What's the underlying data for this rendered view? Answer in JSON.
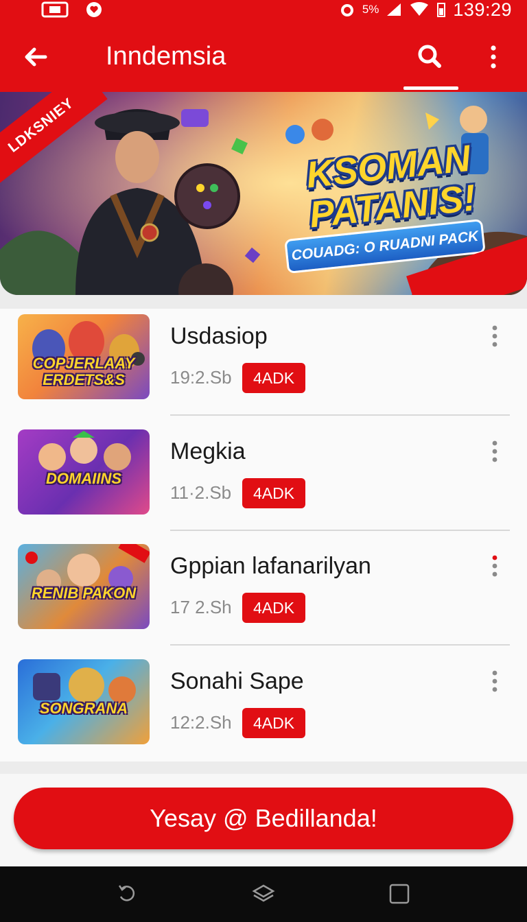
{
  "status_bar": {
    "time": "139:29",
    "misc": "5%",
    "icons": [
      "gallery-icon",
      "heart-icon",
      "alarm-icon",
      "signal-icon",
      "wifi-icon",
      "battery-icon"
    ]
  },
  "app_bar": {
    "title": "Inndemsia",
    "icons": [
      "back-arrow-icon",
      "search-icon",
      "more-vertical-icon"
    ]
  },
  "banner": {
    "corner_label": "LDKSNIEY",
    "headline": "KSOMAN PATANIS!",
    "pack_label": "COUADG: O RUADNI PACK"
  },
  "list": {
    "items": [
      {
        "title": "Usdasiop",
        "size": "19:2.Sb",
        "badge": "4ADK",
        "thumb_text": "COPJERLAAY ERDETS&S",
        "menu_color": "#8a8a8a"
      },
      {
        "title": "Megkia",
        "size": "11·2.Sb",
        "badge": "4ADK",
        "thumb_text": "DOMAIINS",
        "menu_color": "#8a8a8a"
      },
      {
        "title": "Gppian lafanarilyan",
        "size": "17 2.Sh",
        "badge": "4ADK",
        "thumb_text": "RENIB PAKON",
        "menu_color": "#e10e13"
      },
      {
        "title": "Sonahi Sape",
        "size": "12:2.Sh",
        "badge": "4ADK",
        "thumb_text": "SONGRANA",
        "menu_color": "#8a8a8a"
      }
    ]
  },
  "cta": {
    "label": "Yesay @ Bedillanda!"
  },
  "nav_bar": {
    "icons": [
      "back-nav-icon",
      "home-nav-icon",
      "recents-nav-icon"
    ]
  },
  "colors": {
    "accent": "#e10e13",
    "text_primary": "#1a1a1a",
    "text_secondary": "#8a8a8a"
  }
}
